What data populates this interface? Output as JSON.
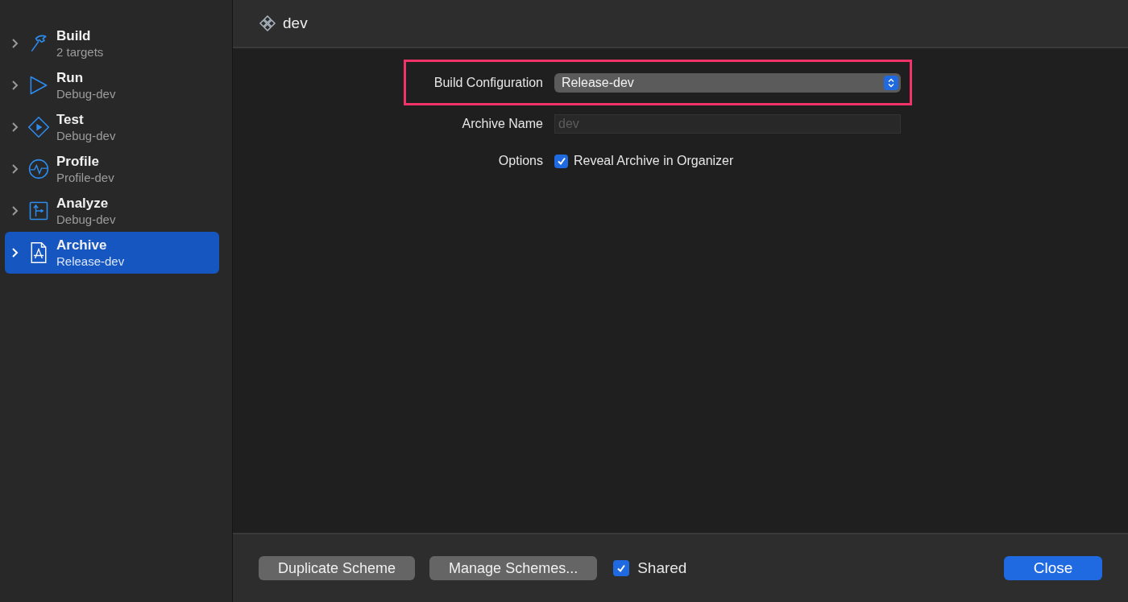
{
  "sidebar": {
    "items": [
      {
        "kind": "build",
        "title": "Build",
        "subtitle": "2 targets",
        "selected": false
      },
      {
        "kind": "run",
        "title": "Run",
        "subtitle": "Debug-dev",
        "selected": false
      },
      {
        "kind": "test",
        "title": "Test",
        "subtitle": "Debug-dev",
        "selected": false
      },
      {
        "kind": "profile",
        "title": "Profile",
        "subtitle": "Profile-dev",
        "selected": false
      },
      {
        "kind": "analyze",
        "title": "Analyze",
        "subtitle": "Debug-dev",
        "selected": false
      },
      {
        "kind": "archive",
        "title": "Archive",
        "subtitle": "Release-dev",
        "selected": true
      }
    ]
  },
  "header": {
    "title": "dev"
  },
  "form": {
    "rows": [
      {
        "kind": "popup",
        "label": "Build Configuration",
        "value": "Release-dev",
        "highlighted": true
      },
      {
        "kind": "text",
        "label": "Archive Name",
        "placeholder": "dev",
        "highlighted": false
      },
      {
        "kind": "checkbox",
        "label": "Options",
        "option": "Reveal Archive in Organizer",
        "checked": true,
        "highlighted": false
      }
    ]
  },
  "footer": {
    "buttons": [
      "Duplicate Scheme",
      "Manage Schemes..."
    ],
    "shared": {
      "label": "Shared",
      "checked": true
    },
    "close": "Close"
  }
}
